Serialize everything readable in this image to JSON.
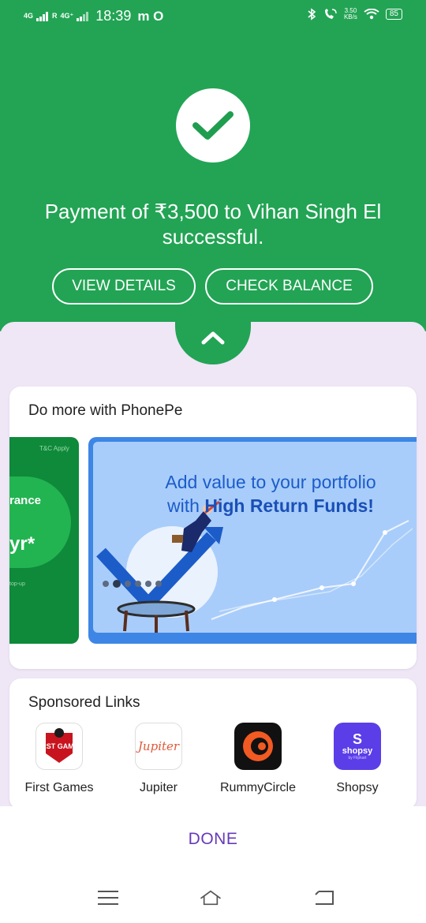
{
  "status_bar": {
    "network_1": "4G",
    "network_2": "4G⁺",
    "roaming": "R",
    "time": "18:39",
    "carrier_icons": "m O",
    "speed_value": "3.50",
    "speed_unit": "KB/s",
    "battery": "85"
  },
  "payment": {
    "message": "Payment of ₹3,500 to Vihan Singh El successful.",
    "view_details_label": "VIEW DETAILS",
    "check_balance_label": "CHECK BALANCE"
  },
  "do_more": {
    "title": "Do more with PhonePe",
    "left_banner": {
      "tc": "T&C Apply",
      "line1": "rance",
      "line2": "yr*",
      "line3": "top-up"
    },
    "main_banner": {
      "headline_1": "Add value to your portfolio",
      "headline_2_prefix": "with ",
      "headline_2_bold": "High Return Funds!"
    },
    "carousel_count": 6,
    "carousel_active_index": 1
  },
  "sponsored": {
    "title": "Sponsored Links",
    "items": [
      {
        "label": "First Games",
        "icon": "first-games-logo",
        "logo_text": "FIRST GAMES"
      },
      {
        "label": "Jupiter",
        "icon": "jupiter-logo",
        "logo_text": "Jupiter"
      },
      {
        "label": "RummyCircle",
        "icon": "rummycircle-logo"
      },
      {
        "label": "Shopsy",
        "icon": "shopsy-logo",
        "logo_text": "shopsy",
        "logo_sub": "by Flipkart"
      }
    ]
  },
  "footer": {
    "done_label": "DONE"
  },
  "colors": {
    "brand_green": "#22a454",
    "sheet_bg": "#efe6f6",
    "done_purple": "#673ab7"
  }
}
